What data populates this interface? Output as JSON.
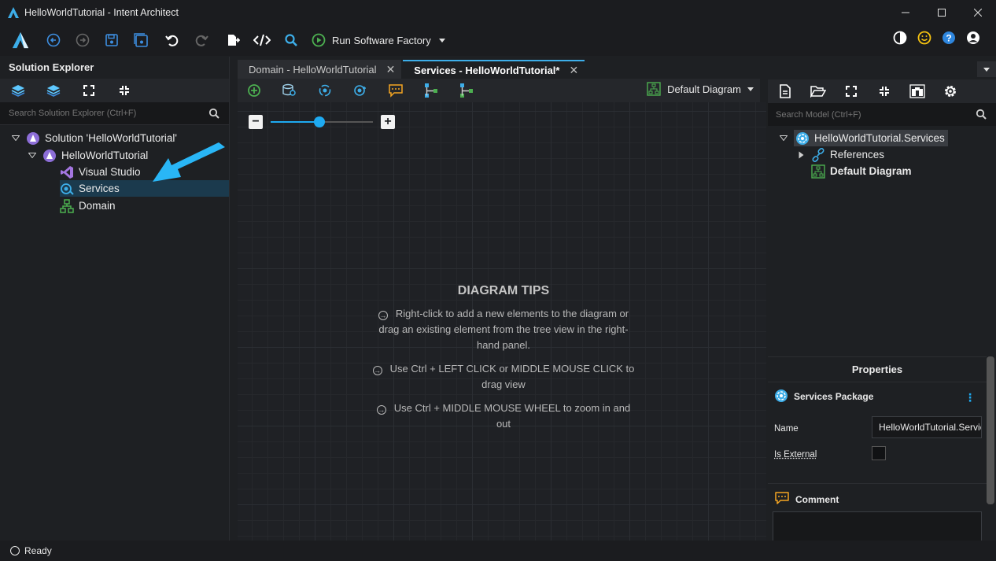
{
  "window": {
    "title": "HelloWorldTutorial - Intent Architect"
  },
  "toolbar": {
    "run_label": "Run Software Factory"
  },
  "solution_explorer": {
    "title": "Solution Explorer",
    "search_placeholder": "Search Solution Explorer (Ctrl+F)",
    "items": [
      {
        "label": "Solution 'HelloWorldTutorial'"
      },
      {
        "label": "HelloWorldTutorial"
      },
      {
        "label": "Visual Studio"
      },
      {
        "label": "Services"
      },
      {
        "label": "Domain"
      }
    ]
  },
  "tabs": [
    {
      "label": "Domain - HelloWorldTutorial"
    },
    {
      "label": "Services - HelloWorldTutorial*"
    }
  ],
  "diagram": {
    "selector_label": "Default Diagram",
    "zoom_level": 0.48,
    "tips_title": "DIAGRAM TIPS",
    "tips": [
      "Right-click to add a new elements to the diagram or drag an existing element from the tree view in the right-hand panel.",
      "Use Ctrl + LEFT CLICK or MIDDLE MOUSE CLICK to drag view",
      "Use Ctrl + MIDDLE MOUSE WHEEL to zoom in and out"
    ]
  },
  "model": {
    "search_placeholder": "Search Model (Ctrl+F)",
    "items": [
      {
        "label": "HelloWorldTutorial.Services"
      },
      {
        "label": "References"
      },
      {
        "label": "Default Diagram"
      }
    ]
  },
  "properties": {
    "title": "Properties",
    "package_label": "Services Package",
    "name_label": "Name",
    "name_value": "HelloWorldTutorial.Services",
    "is_external_label": "Is External",
    "comment_label": "Comment"
  },
  "status": {
    "text": "Ready"
  },
  "colors": {
    "accent": "#1eaaf1",
    "background": "#1e2023",
    "selection": "#1b3a4d",
    "arrow": "#29b6f6"
  }
}
